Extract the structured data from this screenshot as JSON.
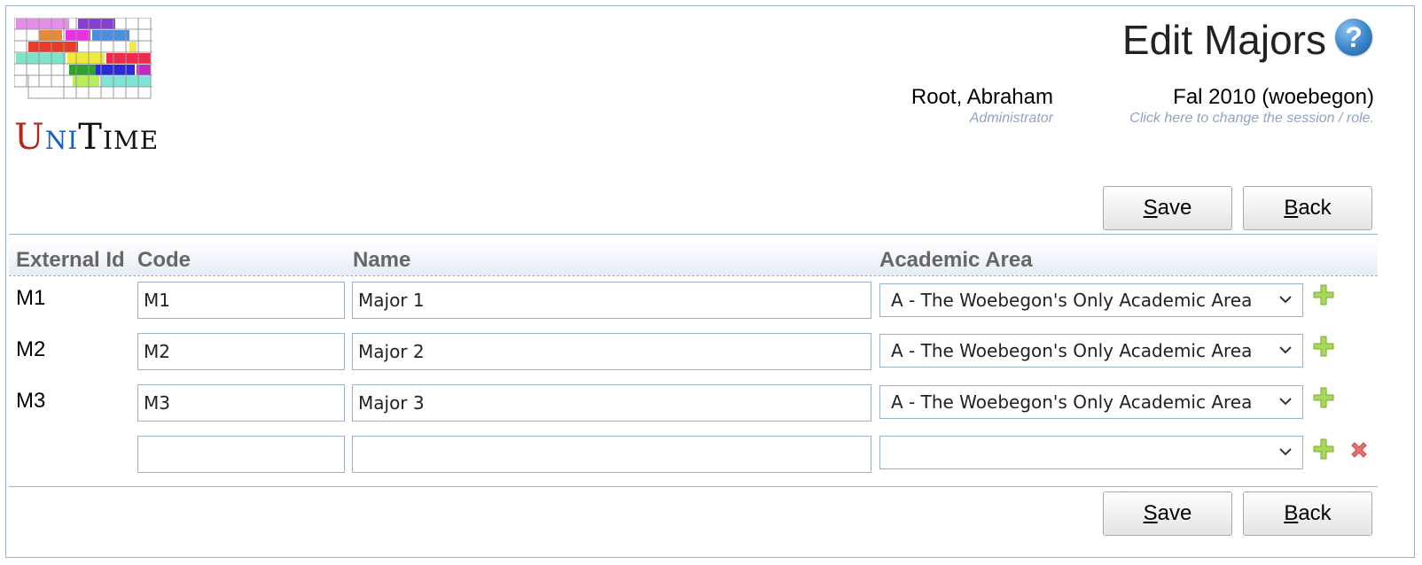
{
  "header": {
    "title": "Edit Majors",
    "help_icon": "help-icon",
    "logo_icon": "unitime-logo",
    "logo_text": [
      "U",
      "NI",
      "T",
      "IME"
    ],
    "user_name": "Root, Abraham",
    "user_role": "Administrator",
    "session_name": "Fal 2010 (woebegon)",
    "session_hint": "Click here to change the session / role."
  },
  "buttons": {
    "save_label_first": "S",
    "save_label_rest": "ave",
    "back_label_first": "B",
    "back_label_rest": "ack"
  },
  "table": {
    "columns": [
      "External Id",
      "Code",
      "Name",
      "Academic Area"
    ],
    "rows": [
      {
        "external_id": "M1",
        "code": "M1",
        "name": "Major 1",
        "academic_area": "A - The Woebegon's Only Academic Area"
      },
      {
        "external_id": "M2",
        "code": "M2",
        "name": "Major 2",
        "academic_area": "A - The Woebegon's Only Academic Area"
      },
      {
        "external_id": "M3",
        "code": "M3",
        "name": "Major 3",
        "academic_area": "A - The Woebegon's Only Academic Area"
      },
      {
        "external_id": "",
        "code": "",
        "name": "",
        "academic_area": ""
      }
    ],
    "add_icon": "plus-icon",
    "delete_icon": "delete-icon"
  },
  "colors": {
    "frame_border": "#9cb0ce",
    "header_text": "#666666",
    "hint_text": "#8fa3c2",
    "add_green": "#9ccc3c",
    "delete_red": "#e06060"
  }
}
